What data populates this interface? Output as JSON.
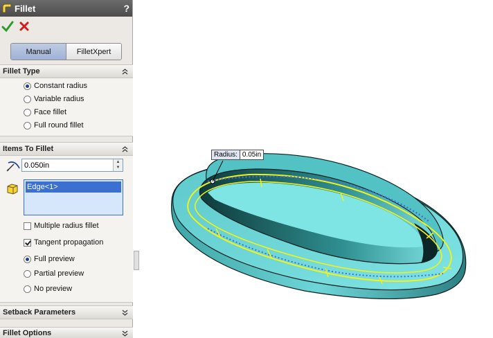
{
  "panel": {
    "title": "Fillet",
    "help_label": "?",
    "modes": {
      "manual": "Manual",
      "filletxpert": "FilletXpert",
      "active": "manual"
    },
    "fillet_type": {
      "header": "Fillet Type",
      "options": [
        "Constant radius",
        "Variable radius",
        "Face fillet",
        "Full round fillet"
      ],
      "selected": "Constant radius"
    },
    "items_to_fillet": {
      "header": "Items To Fillet",
      "radius_value": "0.050in",
      "edges": [
        "Edge<1>"
      ],
      "multiple_radius": "Multiple radius fillet",
      "multiple_radius_checked": false,
      "tangent_propagation": "Tangent propagation",
      "tangent_propagation_checked": true,
      "preview_options": [
        "Full preview",
        "Partial preview",
        "No preview"
      ],
      "preview_selected": "Full preview"
    },
    "setback_header": "Setback Parameters",
    "fillet_options_header": "Fillet Options"
  },
  "viewport": {
    "callout_label": "Radius:",
    "callout_value": "0.05in",
    "model_color": "#6fd6d8",
    "edge_highlight": "#f2f21a"
  }
}
